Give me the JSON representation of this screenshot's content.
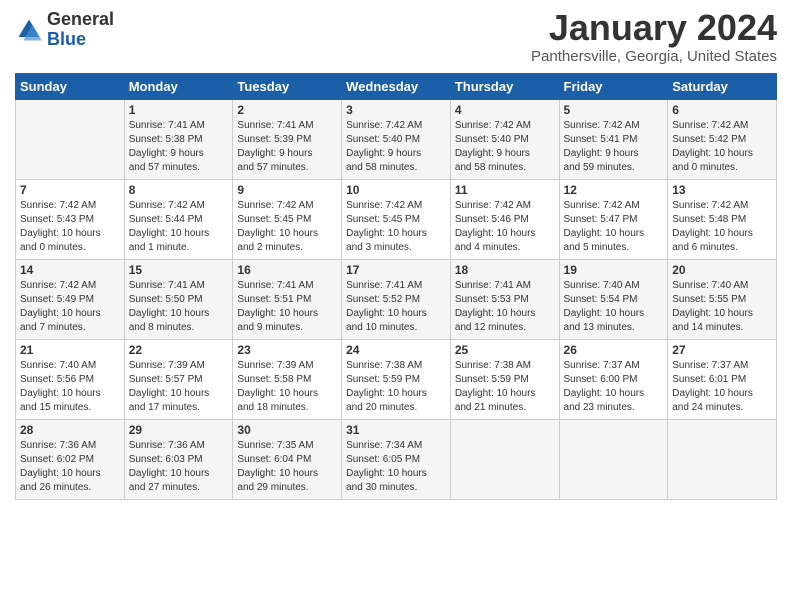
{
  "logo": {
    "general": "General",
    "blue": "Blue"
  },
  "header": {
    "title": "January 2024",
    "subtitle": "Panthersville, Georgia, United States"
  },
  "weekdays": [
    "Sunday",
    "Monday",
    "Tuesday",
    "Wednesday",
    "Thursday",
    "Friday",
    "Saturday"
  ],
  "weeks": [
    [
      {
        "day": "",
        "info": ""
      },
      {
        "day": "1",
        "info": "Sunrise: 7:41 AM\nSunset: 5:38 PM\nDaylight: 9 hours\nand 57 minutes."
      },
      {
        "day": "2",
        "info": "Sunrise: 7:41 AM\nSunset: 5:39 PM\nDaylight: 9 hours\nand 57 minutes."
      },
      {
        "day": "3",
        "info": "Sunrise: 7:42 AM\nSunset: 5:40 PM\nDaylight: 9 hours\nand 58 minutes."
      },
      {
        "day": "4",
        "info": "Sunrise: 7:42 AM\nSunset: 5:40 PM\nDaylight: 9 hours\nand 58 minutes."
      },
      {
        "day": "5",
        "info": "Sunrise: 7:42 AM\nSunset: 5:41 PM\nDaylight: 9 hours\nand 59 minutes."
      },
      {
        "day": "6",
        "info": "Sunrise: 7:42 AM\nSunset: 5:42 PM\nDaylight: 10 hours\nand 0 minutes."
      }
    ],
    [
      {
        "day": "7",
        "info": "Sunrise: 7:42 AM\nSunset: 5:43 PM\nDaylight: 10 hours\nand 0 minutes."
      },
      {
        "day": "8",
        "info": "Sunrise: 7:42 AM\nSunset: 5:44 PM\nDaylight: 10 hours\nand 1 minute."
      },
      {
        "day": "9",
        "info": "Sunrise: 7:42 AM\nSunset: 5:45 PM\nDaylight: 10 hours\nand 2 minutes."
      },
      {
        "day": "10",
        "info": "Sunrise: 7:42 AM\nSunset: 5:45 PM\nDaylight: 10 hours\nand 3 minutes."
      },
      {
        "day": "11",
        "info": "Sunrise: 7:42 AM\nSunset: 5:46 PM\nDaylight: 10 hours\nand 4 minutes."
      },
      {
        "day": "12",
        "info": "Sunrise: 7:42 AM\nSunset: 5:47 PM\nDaylight: 10 hours\nand 5 minutes."
      },
      {
        "day": "13",
        "info": "Sunrise: 7:42 AM\nSunset: 5:48 PM\nDaylight: 10 hours\nand 6 minutes."
      }
    ],
    [
      {
        "day": "14",
        "info": "Sunrise: 7:42 AM\nSunset: 5:49 PM\nDaylight: 10 hours\nand 7 minutes."
      },
      {
        "day": "15",
        "info": "Sunrise: 7:41 AM\nSunset: 5:50 PM\nDaylight: 10 hours\nand 8 minutes."
      },
      {
        "day": "16",
        "info": "Sunrise: 7:41 AM\nSunset: 5:51 PM\nDaylight: 10 hours\nand 9 minutes."
      },
      {
        "day": "17",
        "info": "Sunrise: 7:41 AM\nSunset: 5:52 PM\nDaylight: 10 hours\nand 10 minutes."
      },
      {
        "day": "18",
        "info": "Sunrise: 7:41 AM\nSunset: 5:53 PM\nDaylight: 10 hours\nand 12 minutes."
      },
      {
        "day": "19",
        "info": "Sunrise: 7:40 AM\nSunset: 5:54 PM\nDaylight: 10 hours\nand 13 minutes."
      },
      {
        "day": "20",
        "info": "Sunrise: 7:40 AM\nSunset: 5:55 PM\nDaylight: 10 hours\nand 14 minutes."
      }
    ],
    [
      {
        "day": "21",
        "info": "Sunrise: 7:40 AM\nSunset: 5:56 PM\nDaylight: 10 hours\nand 15 minutes."
      },
      {
        "day": "22",
        "info": "Sunrise: 7:39 AM\nSunset: 5:57 PM\nDaylight: 10 hours\nand 17 minutes."
      },
      {
        "day": "23",
        "info": "Sunrise: 7:39 AM\nSunset: 5:58 PM\nDaylight: 10 hours\nand 18 minutes."
      },
      {
        "day": "24",
        "info": "Sunrise: 7:38 AM\nSunset: 5:59 PM\nDaylight: 10 hours\nand 20 minutes."
      },
      {
        "day": "25",
        "info": "Sunrise: 7:38 AM\nSunset: 5:59 PM\nDaylight: 10 hours\nand 21 minutes."
      },
      {
        "day": "26",
        "info": "Sunrise: 7:37 AM\nSunset: 6:00 PM\nDaylight: 10 hours\nand 23 minutes."
      },
      {
        "day": "27",
        "info": "Sunrise: 7:37 AM\nSunset: 6:01 PM\nDaylight: 10 hours\nand 24 minutes."
      }
    ],
    [
      {
        "day": "28",
        "info": "Sunrise: 7:36 AM\nSunset: 6:02 PM\nDaylight: 10 hours\nand 26 minutes."
      },
      {
        "day": "29",
        "info": "Sunrise: 7:36 AM\nSunset: 6:03 PM\nDaylight: 10 hours\nand 27 minutes."
      },
      {
        "day": "30",
        "info": "Sunrise: 7:35 AM\nSunset: 6:04 PM\nDaylight: 10 hours\nand 29 minutes."
      },
      {
        "day": "31",
        "info": "Sunrise: 7:34 AM\nSunset: 6:05 PM\nDaylight: 10 hours\nand 30 minutes."
      },
      {
        "day": "",
        "info": ""
      },
      {
        "day": "",
        "info": ""
      },
      {
        "day": "",
        "info": ""
      }
    ]
  ]
}
